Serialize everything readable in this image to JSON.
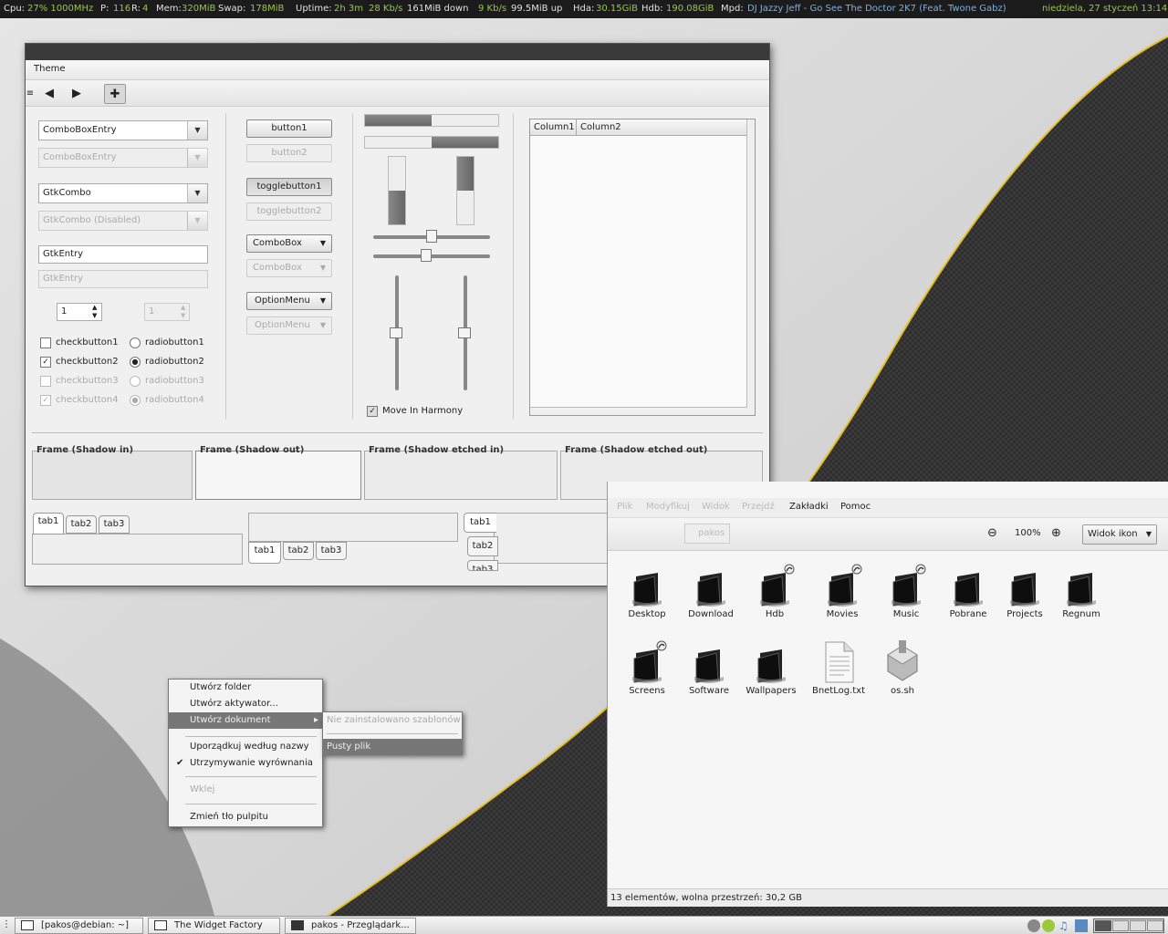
{
  "topbar": {
    "cpu_label": "Cpu:",
    "cpu_value": "27% 1000MHz",
    "p_label": "P:",
    "p_value": "116",
    "r_label": "R:",
    "r_value": "4",
    "mem_label": "Mem:",
    "mem_value": "320MiB",
    "swap_label": "Swap:",
    "swap_value": "178MiB",
    "uptime_label": "Uptime:",
    "uptime_value": "2h 3m",
    "down_rate": "28 Kb/s",
    "down_total": "161MiB down",
    "up_rate": "9 Kb/s",
    "up_total": "99.5MiB up",
    "hda_label": "Hda:",
    "hda_value": "30.15GiB",
    "hdb_label": "Hdb:",
    "hdb_value": "190.08GiB",
    "mpd_label": "Mpd:",
    "mpd_value": "DJ Jazzy Jeff - Go See The Doctor 2K7 (Feat. Twone Gabz)",
    "date": "niedziela, 27 styczeń 13:14"
  },
  "widget_factory": {
    "menu_theme": "Theme",
    "toolbar_icons": [
      "handle-icon",
      "back-icon",
      "forward-icon",
      "add-icon"
    ],
    "col1": {
      "combobox_entry": "ComboBoxEntry",
      "combobox_entry_disabled": "ComboBoxEntry",
      "gtkcombo": "GtkCombo",
      "gtkcombo_disabled": "GtkCombo (Disabled)",
      "gtkentry": "GtkEntry",
      "gtkentry_disabled_placeholder": "GtkEntry",
      "spin1": "1",
      "spin2": "1",
      "check1": "checkbutton1",
      "check2": "checkbutton2",
      "check3": "checkbutton3",
      "check4": "checkbutton4",
      "radio1": "radiobutton1",
      "radio2": "radiobutton2",
      "radio3": "radiobutton3",
      "radio4": "radiobutton4",
      "check_mark": "✓",
      "radio_mark": "●"
    },
    "col2": {
      "button1": "button1",
      "button2": "button2",
      "toggle1": "togglebutton1",
      "toggle2": "togglebutton2",
      "combobox": "ComboBox",
      "combobox_disabled": "ComboBox",
      "optionmenu": "OptionMenu",
      "optionmenu_disabled": "OptionMenu"
    },
    "col3": {
      "move_in_harmony": "Move In Harmony",
      "progress": [
        0.5,
        0.5,
        0.5,
        0.5
      ],
      "hscale": [
        0.5,
        0.45
      ],
      "vscale": [
        0.5,
        0.5
      ]
    },
    "treeview": {
      "columns": [
        "Column1",
        "Column2"
      ]
    },
    "frames": [
      "Frame (Shadow in)",
      "Frame (Shadow out)",
      "Frame (Shadow etched in)",
      "Frame (Shadow etched out)"
    ],
    "tabs": [
      "tab1",
      "tab2",
      "tab3"
    ]
  },
  "file_manager": {
    "menu": [
      "Plik",
      "Modyfikuj",
      "Widok",
      "Przejdź",
      "Zakładki",
      "Pomoc"
    ],
    "zoom": "100%",
    "view_mode": "Widok ikon",
    "location": "pakos",
    "items": [
      {
        "name": "Desktop",
        "icon": "folder-icon"
      },
      {
        "name": "Download",
        "icon": "folder-icon"
      },
      {
        "name": "Hdb",
        "icon": "folder-link-icon"
      },
      {
        "name": "Movies",
        "icon": "folder-link-icon"
      },
      {
        "name": "Music",
        "icon": "folder-link-icon"
      },
      {
        "name": "Pobrane",
        "icon": "folder-icon"
      },
      {
        "name": "Projects",
        "icon": "folder-icon"
      },
      {
        "name": "Regnum",
        "icon": "folder-icon"
      },
      {
        "name": "Screens",
        "icon": "folder-link-icon"
      },
      {
        "name": "Software",
        "icon": "folder-icon"
      },
      {
        "name": "Wallpapers",
        "icon": "folder-icon"
      },
      {
        "name": "BnetLog.txt",
        "icon": "text-file-icon"
      },
      {
        "name": "os.sh",
        "icon": "script-icon"
      }
    ],
    "status": "13 elementów, wolna przestrzeń: 30,2 GB"
  },
  "context_menu": {
    "items": [
      "Utwórz folder",
      "Utwórz aktywator...",
      "Utwórz dokument",
      "Uporządkuj według nazwy",
      "Utrzymywanie wyrównania",
      "Wklej",
      "Zmień tło pulpitu"
    ],
    "submenu": [
      "Nie zainstalowano szablonów",
      "Pusty plik"
    ],
    "submenu_arrow": "▸",
    "check": "✔"
  },
  "taskbar": {
    "tasks": [
      "[pakos@debian: ~]",
      "The Widget Factory",
      "pakos - Przeglądark..."
    ]
  },
  "colors": {
    "accent_green": "#9bc93c",
    "accent_blue": "#7fb0e0",
    "panel_dark": "#1b1b1b"
  }
}
